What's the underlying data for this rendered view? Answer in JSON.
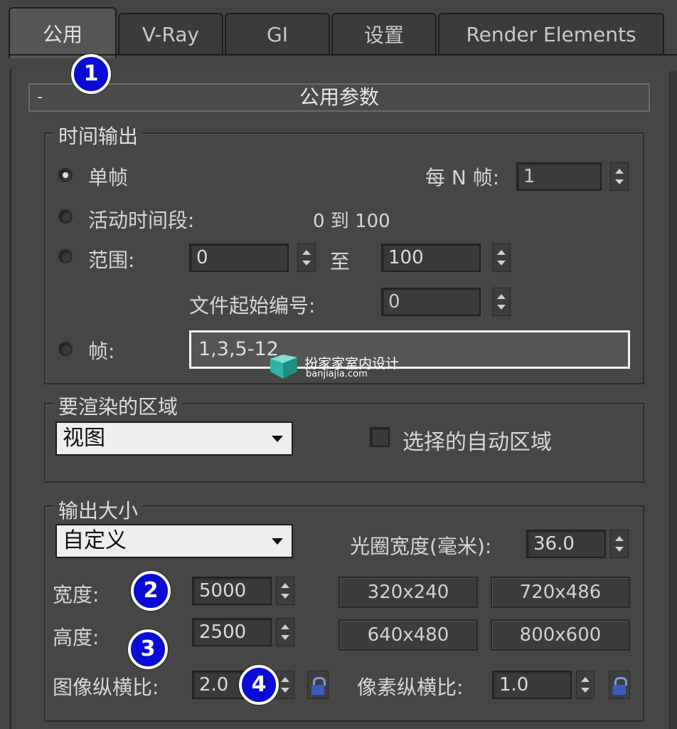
{
  "tabs": [
    "公用",
    "V-Ray",
    "GI",
    "设置",
    "Render Elements"
  ],
  "rollout": {
    "collapse": "-",
    "title": "公用参数"
  },
  "time_output": {
    "title": "时间输出",
    "single": "单帧",
    "every_n": "每 N 帧:",
    "every_n_value": "1",
    "active": "活动时间段:",
    "active_range": "0 到 100",
    "range": "范围:",
    "range_from": "0",
    "to": "至",
    "range_to": "100",
    "file_start": "文件起始编号:",
    "file_start_value": "0",
    "frames": "帧:",
    "frames_value": "1,3,5-12"
  },
  "area": {
    "title": "要渲染的区域",
    "dropdown": "视图",
    "auto_region": "选择的自动区域"
  },
  "output_size": {
    "title": "输出大小",
    "dropdown": "自定义",
    "aperture_label": "光圈宽度(毫米):",
    "aperture_value": "36.0",
    "width_label": "宽度:",
    "width_value": "5000",
    "height_label": "高度:",
    "height_value": "2500",
    "image_aspect_label": "图像纵横比:",
    "image_aspect_value": "2.0",
    "pixel_aspect_label": "像素纵横比:",
    "pixel_aspect_value": "1.0",
    "presets": [
      "320x240",
      "720x486",
      "640x480",
      "800x600"
    ]
  },
  "badges": [
    "1",
    "2",
    "3",
    "4"
  ],
  "watermark": {
    "text": "扮家家室内设计",
    "sub": "banjiajia.com"
  },
  "colors": {
    "badge": "#0b0bd6",
    "panel": "#464646"
  }
}
